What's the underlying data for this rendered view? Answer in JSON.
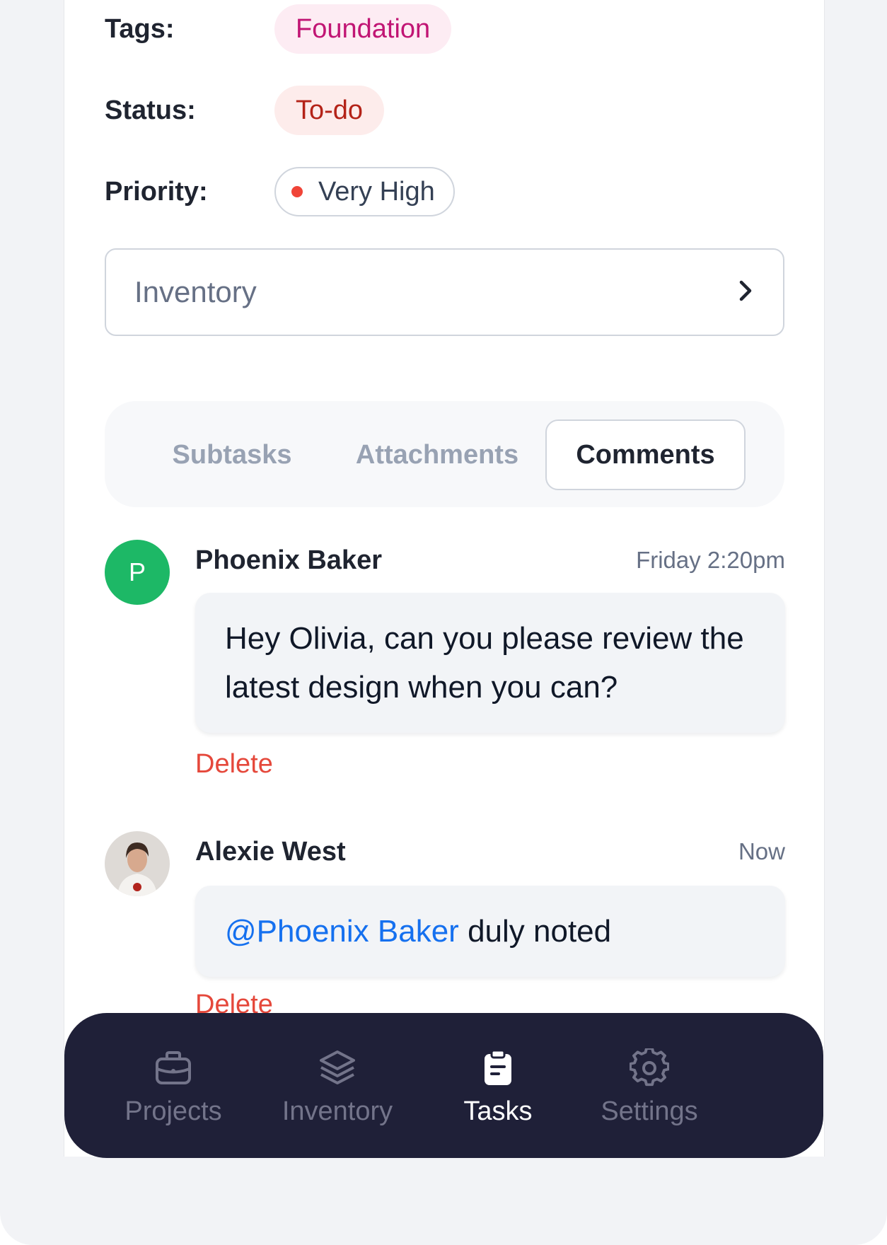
{
  "details": {
    "tags_label": "Tags:",
    "tag_value": "Foundation",
    "status_label": "Status:",
    "status_value": "To-do",
    "priority_label": "Priority:",
    "priority_value": "Very High"
  },
  "project_select": {
    "value": "Inventory",
    "icon": "chevron-right-icon"
  },
  "tabs": [
    {
      "label": "Subtasks",
      "active": false
    },
    {
      "label": "Attachments",
      "active": false
    },
    {
      "label": "Comments",
      "active": true
    }
  ],
  "comments": [
    {
      "author": "Phoenix Baker",
      "avatar_letter": "P",
      "time": "Friday 2:20pm",
      "text": "Hey Olivia, can you please review the latest design when you can?",
      "delete_label": "Delete"
    },
    {
      "author": "Alexie West",
      "avatar_letter": "",
      "time": "Now",
      "mention": "@Phoenix Baker",
      "text": " duly noted",
      "delete_label": "Delete"
    }
  ],
  "nav": [
    {
      "label": "Projects",
      "icon": "briefcase-icon",
      "active": false
    },
    {
      "label": "Inventory",
      "icon": "layers-icon",
      "active": false
    },
    {
      "label": "Tasks",
      "icon": "clipboard-icon",
      "active": true
    },
    {
      "label": "Settings",
      "icon": "gear-icon",
      "active": false
    }
  ],
  "colors": {
    "navbar_bg": "#1f2038",
    "tag_text": "#c11574",
    "status_text": "#b42318",
    "priority_dot": "#f04438",
    "avatar_green": "#1db866",
    "mention": "#1570ef",
    "delete": "#e5483b"
  }
}
